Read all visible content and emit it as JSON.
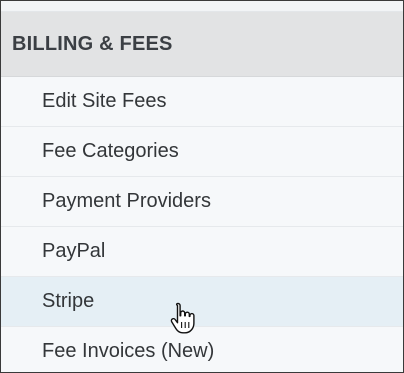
{
  "section": {
    "title": "BILLING & FEES"
  },
  "menu": {
    "items": [
      {
        "label": "Edit Site Fees"
      },
      {
        "label": "Fee Categories"
      },
      {
        "label": "Payment Providers"
      },
      {
        "label": "PayPal"
      },
      {
        "label": "Stripe",
        "hovered": true
      },
      {
        "label": "Fee Invoices (New)"
      }
    ]
  },
  "cursor": {
    "icon": "hand-pointer-icon"
  },
  "colors": {
    "header_bg": "#e2e3e4",
    "menu_bg": "#f6f8fa",
    "hover_bg": "#e5eff5",
    "text": "#333639"
  }
}
